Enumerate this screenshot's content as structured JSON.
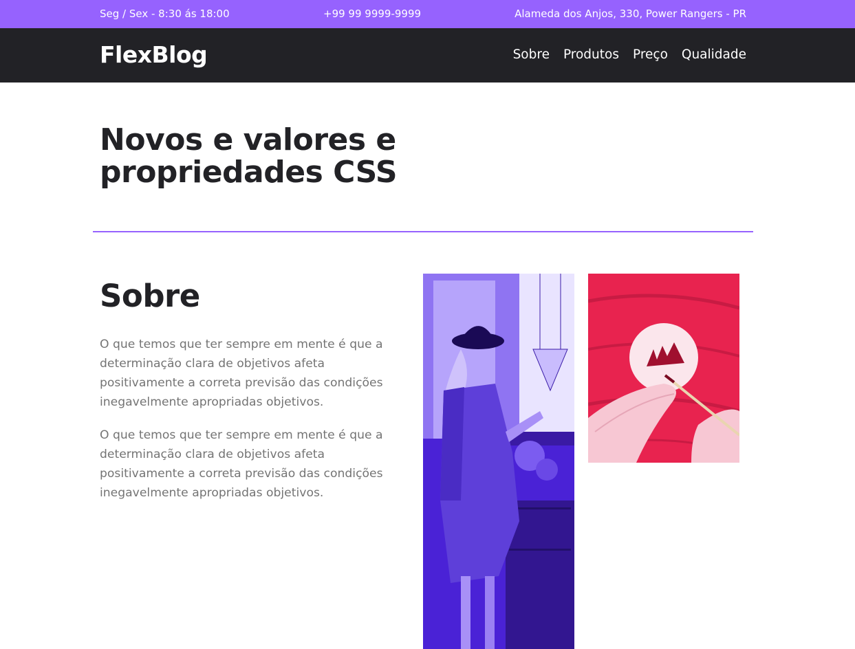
{
  "topbar": {
    "hours": "Seg / Sex - 8:30 ás 18:00",
    "phone": "+99 99 9999-9999",
    "address": "Alameda dos Anjos, 330, Power Rangers - PR"
  },
  "header": {
    "logo": "FlexBlog",
    "nav": [
      "Sobre",
      "Produtos",
      "Preço",
      "Qualidade"
    ]
  },
  "intro": {
    "title": "Novos e valores e propriedades CSS"
  },
  "about": {
    "title": "Sobre",
    "paragraphs": [
      "O que temos que ter sempre em mente é que a determinação clara de objetivos afeta positivamente a correta previsão das condições inegavelmente apropriadas objetivos.",
      "O que temos que ter sempre em mente é que a determinação clara de objetivos afeta positivamente a correta previsão das condições inegavelmente apropriadas objetivos."
    ]
  },
  "colors": {
    "accent": "#9662fe",
    "dark": "#222226",
    "photo_purple": "#5a2ee0",
    "photo_pink": "#f2356a"
  },
  "images": {
    "tall": "woman-with-hat-purple-photo",
    "square": "hands-painting-pink-photo"
  }
}
